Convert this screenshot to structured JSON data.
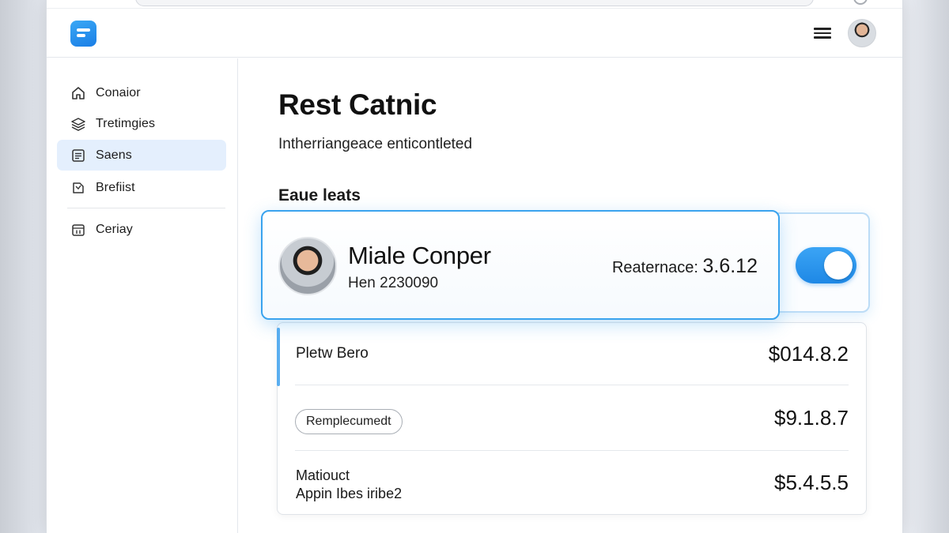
{
  "header": {
    "logo_icon": "app-logo-icon",
    "menu_icon": "hamburger-menu-icon",
    "avatar_icon": "user-avatar-icon"
  },
  "sidebar": {
    "items": [
      {
        "label": "Conaior",
        "icon": "home-icon",
        "active": false
      },
      {
        "label": "Tretimgies",
        "icon": "layers-icon",
        "active": false
      },
      {
        "label": "Saens",
        "icon": "list-box-icon",
        "active": true
      },
      {
        "label": "Brefiist",
        "icon": "tag-icon",
        "active": false
      },
      {
        "label": "Ceriay",
        "icon": "calendar-icon",
        "active": false
      }
    ]
  },
  "main": {
    "title": "Rest Catnic",
    "subtitle": "Intherriangeace enticontleted",
    "section_heading": "Eaue leats",
    "profile": {
      "name": "Miale Conper",
      "id_line": "Hen 2230090",
      "metric_label": "Reaternace:",
      "metric_value": "3.6.12",
      "toggle_on": true
    },
    "rows": [
      {
        "label": "Pletw Bero",
        "amount": "$014.8.2"
      },
      {
        "chip": "Remplecumedt",
        "amount": "$9.1.8.7"
      },
      {
        "label_line1": "Matiouct",
        "label_line2": "Appin Ibes iribe2",
        "amount": "$5.4.5.5"
      }
    ]
  },
  "colors": {
    "accent": "#1e88e5",
    "accent_light": "#e4effd",
    "card_border": "#3aa3ee"
  }
}
